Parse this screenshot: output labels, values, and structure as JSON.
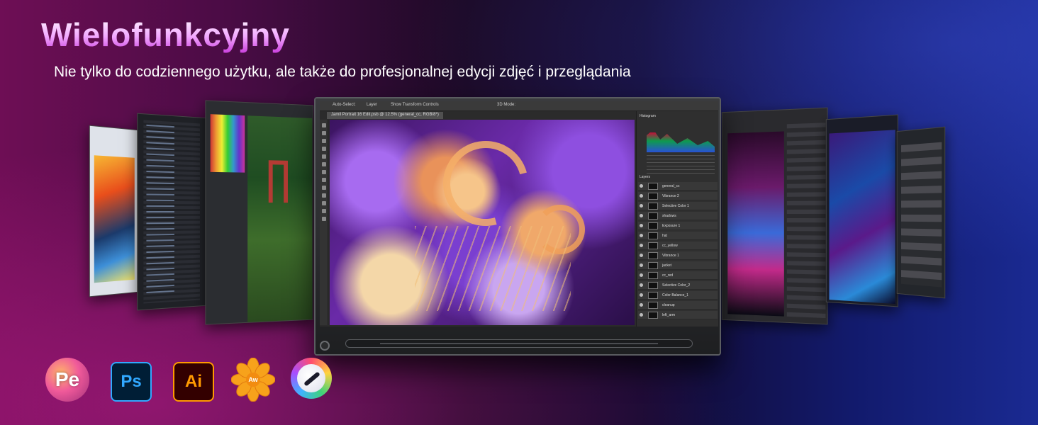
{
  "header": {
    "title": "Wielofunkcyjny",
    "subtitle": "Nie tylko do codziennego użytku, ale także do profesjonalnej edycji zdjęć i przeglądania"
  },
  "monitor": {
    "app": "photoshop",
    "document_tab": "Jamil Portrait 16 Edit.psb @ 12.5% (general_cc, RGB/8*)",
    "toolbar": {
      "auto_select": "Auto-Select:",
      "layer": "Layer",
      "show_transform": "Show Transform Controls",
      "mode": "3D Mode:"
    },
    "panels": {
      "histogram_title": "Histogram",
      "layers_title": "Layers",
      "layers": [
        "general_cc",
        "Vibrance 2",
        "Selective Color 1",
        "shadows",
        "Exposure 1",
        "hat",
        "cc_yellow",
        "Vibrance 1",
        "jacket",
        "cc_red",
        "Selective Color_2",
        "Color Balance_1",
        "cleanup",
        "left_arm"
      ]
    }
  },
  "side_screens": [
    "paint-program",
    "code-editor",
    "painting-app-forest",
    "photo-editor-vehicle",
    "photo-editor-abstract",
    "video-editor"
  ],
  "apps": [
    {
      "name": "premiere-elements-icon",
      "label": "Pe"
    },
    {
      "name": "photoshop-icon",
      "label": "Ps"
    },
    {
      "name": "illustrator-icon",
      "label": "Ai"
    },
    {
      "name": "artweaver-icon",
      "label": "Aw"
    },
    {
      "name": "krita-icon",
      "label": ""
    }
  ],
  "colors": {
    "ps_blue": "#31a8ff",
    "ai_orange": "#ff9a00",
    "title_pink": "#f2a7ff"
  }
}
